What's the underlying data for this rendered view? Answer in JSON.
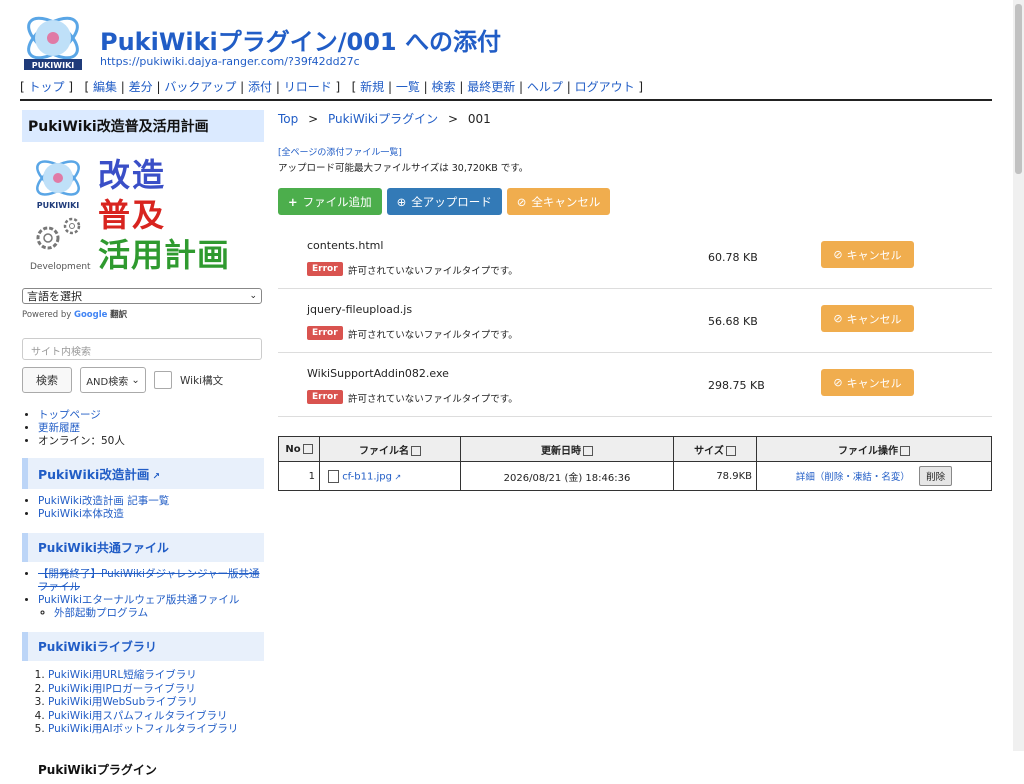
{
  "header": {
    "title": "PukiWikiプラグイン/001 への添付",
    "url": "https://pukiwiki.dajya-ranger.com/?39f42dd27c",
    "logo_text": "PUKIWIKI"
  },
  "nav": {
    "group1": [
      "トップ"
    ],
    "group2": [
      "編集",
      "差分",
      "バックアップ",
      "添付",
      "リロード"
    ],
    "group3": [
      "新規",
      "一覧",
      "検索",
      "最終更新",
      "ヘルプ",
      "ログアウト"
    ]
  },
  "sidebar": {
    "heading": "PukiWiki改造普及活用計画",
    "banner": {
      "line1": "改造",
      "line2": "普及",
      "line3": "活用計画",
      "dev_label": "Development"
    },
    "language_select": "言語を選択",
    "powered_by": "Powered by",
    "google": "Google",
    "translate": "翻訳",
    "search_placeholder": "サイト内検索",
    "search_button": "検索",
    "search_mode": "AND検索",
    "wiki_syntax": "Wiki構文",
    "links1": [
      "トップページ",
      "更新履歴"
    ],
    "online": "オンライン：50人",
    "section1": {
      "title": "PukiWiki改造計画",
      "items": [
        "PukiWiki改造計画 記事一覧",
        "PukiWiki本体改造"
      ]
    },
    "section2": {
      "title": "PukiWiki共通ファイル",
      "items": [
        "【開発終了】PukiWikiダジャレンジャー版共通ファイル",
        "PukiWikiエターナルウェア版共通ファイル"
      ],
      "subitems": [
        "外部起動プログラム"
      ]
    },
    "section3": {
      "title": "PukiWikiライブラリ",
      "items": [
        "PukiWiki用URL短縮ライブラリ",
        "PukiWiki用IPロガーライブラリ",
        "PukiWiki用WebSubライブラリ",
        "PukiWiki用スパムフィルタライブラリ",
        "PukiWiki用AIボットフィルタライブラリ"
      ]
    },
    "section4": {
      "title": "PukiWikiプラグイン"
    }
  },
  "main": {
    "breadcrumb": [
      "Top",
      "PukiWikiプラグイン",
      "001"
    ],
    "breadcrumb_sep": ">",
    "all_attach_link": "[全ページの添付ファイル一覧]",
    "max_size": "アップロード可能最大ファイルサイズは 30,720KB です。",
    "buttons": {
      "add": "ファイル追加",
      "upload": "全アップロード",
      "cancel": "全キャンセル"
    },
    "error_badge": "Error",
    "error_msg": "許可されていないファイルタイプです。",
    "cancel_label": "キャンセル",
    "uploads": [
      {
        "name": "contents.html",
        "size": "60.78 KB"
      },
      {
        "name": "jquery-fileupload.js",
        "size": "56.68 KB"
      },
      {
        "name": "WikiSupportAddin082.exe",
        "size": "298.75 KB"
      }
    ]
  },
  "table": {
    "headers": [
      "No",
      "ファイル名",
      "更新日時",
      "サイズ",
      "ファイル操作"
    ],
    "row": {
      "no": "1",
      "file": "cf-b11.jpg",
      "date": "2026/08/21 (金) 18:46:36",
      "size": "78.9KB",
      "ops": "詳細（削除・凍結・名変）",
      "delete": "削除"
    }
  },
  "colors": {
    "link": "#215dc6",
    "success": "#4cae4c",
    "primary": "#337ab7",
    "warning": "#f0ad4e",
    "danger": "#d9534f"
  }
}
